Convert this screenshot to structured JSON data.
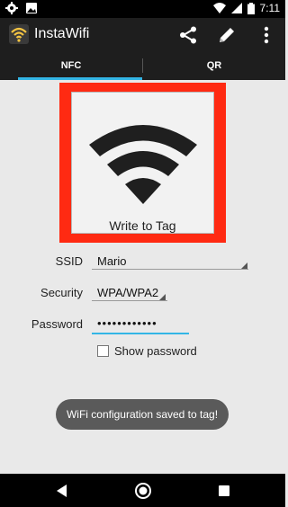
{
  "status_bar": {
    "time": "7:11",
    "icons_left": [
      "gear-icon",
      "image-icon"
    ],
    "icons_right": [
      "wifi-icon",
      "signal-icon",
      "battery-icon"
    ]
  },
  "app_bar": {
    "title": "InstaWifi",
    "logo": "wifi-logo-icon",
    "actions": [
      "share-icon",
      "edit-icon",
      "overflow-menu-icon"
    ]
  },
  "tabs": [
    {
      "label": "NFC",
      "selected": true
    },
    {
      "label": "QR",
      "selected": false
    }
  ],
  "colors": {
    "accent": "#33b5e5",
    "tag_frame": "#ff2a12",
    "toolbar": "#1e1e1e"
  },
  "tag_card": {
    "label": "Write to Tag",
    "icon": "wifi-icon"
  },
  "form": {
    "ssid": {
      "label": "SSID",
      "value": "Mario"
    },
    "security": {
      "label": "Security",
      "value": "WPA/WPA2"
    },
    "password": {
      "label": "Password",
      "value": "••••••••••••"
    },
    "show_password": {
      "label": "Show password",
      "checked": false
    }
  },
  "toast": {
    "text": "WiFi configuration saved to tag!"
  },
  "nav_bar": {
    "buttons": [
      "back-icon",
      "home-icon",
      "recents-icon"
    ]
  }
}
